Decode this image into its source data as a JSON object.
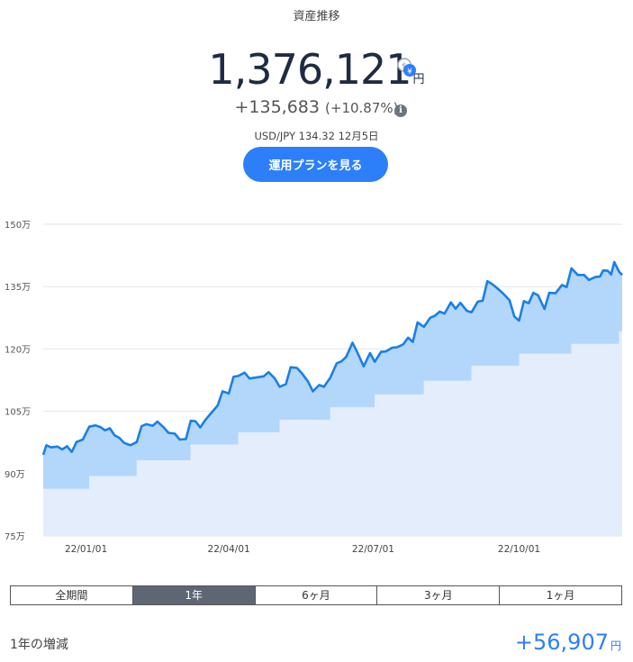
{
  "header": {
    "title": "資産推移"
  },
  "summary": {
    "total": "1,376,121",
    "total_unit": "円",
    "change": "+135,683",
    "change_pct": "(+10.87%)",
    "fx_label": "USD/JPY 134.32 12月5日",
    "plan_button": "運用プランを見る",
    "currency_toggle_icon": "dollar-yen-toggle-icon",
    "info_icon": "info-icon"
  },
  "colors": {
    "accent": "#2d7ff9",
    "line": "#1a7fe8",
    "area_upper": "#b3d7fb",
    "area_lower": "#e3edfb",
    "active_tab": "#5f6673"
  },
  "chart_data": {
    "type": "area",
    "y_ticks": [
      "150万",
      "135万",
      "120万",
      "105万",
      "90万",
      "75万"
    ],
    "ylim": [
      75,
      150
    ],
    "x_ticks": [
      {
        "label": "22/01/01",
        "x": "2022-01-01"
      },
      {
        "label": "22/04/01",
        "x": "2022-04-01"
      },
      {
        "label": "22/07/01",
        "x": "2022-07-01"
      },
      {
        "label": "22/10/01",
        "x": "2022-10-01"
      }
    ],
    "xlim": [
      "2021-12-05",
      "2022-12-05"
    ],
    "grid": true,
    "series": [
      {
        "role": "valuation",
        "points": [
          [
            "2021-12-05",
            94.5
          ],
          [
            "2021-12-07",
            96.8
          ],
          [
            "2021-12-10",
            96.3
          ],
          [
            "2021-12-14",
            96.5
          ],
          [
            "2021-12-17",
            95.8
          ],
          [
            "2021-12-20",
            96.6
          ],
          [
            "2021-12-23",
            95.2
          ],
          [
            "2021-12-26",
            97.6
          ],
          [
            "2021-12-30",
            98.2
          ],
          [
            "2022-01-03",
            101.3
          ],
          [
            "2022-01-07",
            101.6
          ],
          [
            "2022-01-10",
            101.2
          ],
          [
            "2022-01-13",
            100.4
          ],
          [
            "2022-01-16",
            100.9
          ],
          [
            "2022-01-19",
            99.2
          ],
          [
            "2022-01-22",
            98.6
          ],
          [
            "2022-01-25",
            97.4
          ],
          [
            "2022-01-29",
            96.8
          ],
          [
            "2022-02-02",
            97.6
          ],
          [
            "2022-02-05",
            101.4
          ],
          [
            "2022-02-08",
            101.9
          ],
          [
            "2022-02-12",
            101.5
          ],
          [
            "2022-02-15",
            102.5
          ],
          [
            "2022-02-19",
            101.1
          ],
          [
            "2022-02-22",
            99.8
          ],
          [
            "2022-02-26",
            99.6
          ],
          [
            "2022-03-01",
            98.2
          ],
          [
            "2022-03-05",
            98.3
          ],
          [
            "2022-03-08",
            102.7
          ],
          [
            "2022-03-11",
            102.6
          ],
          [
            "2022-03-14",
            101.1
          ],
          [
            "2022-03-17",
            102.8
          ],
          [
            "2022-03-21",
            104.6
          ],
          [
            "2022-03-25",
            106.4
          ],
          [
            "2022-03-28",
            109.8
          ],
          [
            "2022-04-01",
            109.3
          ],
          [
            "2022-04-04",
            113.3
          ],
          [
            "2022-04-07",
            113.5
          ],
          [
            "2022-04-11",
            114.3
          ],
          [
            "2022-04-14",
            112.9
          ],
          [
            "2022-04-18",
            113.1
          ],
          [
            "2022-04-23",
            113.4
          ],
          [
            "2022-04-26",
            114.4
          ],
          [
            "2022-04-30",
            112.9
          ],
          [
            "2022-05-03",
            110.9
          ],
          [
            "2022-05-07",
            111.5
          ],
          [
            "2022-05-10",
            115.6
          ],
          [
            "2022-05-14",
            115.4
          ],
          [
            "2022-05-17",
            114.2
          ],
          [
            "2022-05-21",
            112.1
          ],
          [
            "2022-05-24",
            109.8
          ],
          [
            "2022-05-28",
            111.3
          ],
          [
            "2022-05-31",
            110.9
          ],
          [
            "2022-06-04",
            113.1
          ],
          [
            "2022-06-08",
            116.5
          ],
          [
            "2022-06-11",
            117.0
          ],
          [
            "2022-06-14",
            118.1
          ],
          [
            "2022-06-18",
            121.5
          ],
          [
            "2022-06-21",
            119.2
          ],
          [
            "2022-06-25",
            115.8
          ],
          [
            "2022-06-29",
            119.0
          ],
          [
            "2022-07-02",
            116.9
          ],
          [
            "2022-07-06",
            119.3
          ],
          [
            "2022-07-09",
            119.4
          ],
          [
            "2022-07-13",
            120.3
          ],
          [
            "2022-07-16",
            120.4
          ],
          [
            "2022-07-20",
            121.1
          ],
          [
            "2022-07-23",
            122.7
          ],
          [
            "2022-07-26",
            121.7
          ],
          [
            "2022-07-29",
            126.4
          ],
          [
            "2022-08-02",
            125.3
          ],
          [
            "2022-08-06",
            127.5
          ],
          [
            "2022-08-09",
            128.0
          ],
          [
            "2022-08-12",
            129.0
          ],
          [
            "2022-08-15",
            128.5
          ],
          [
            "2022-08-19",
            131.2
          ],
          [
            "2022-08-22",
            129.7
          ],
          [
            "2022-08-25",
            131.1
          ],
          [
            "2022-08-29",
            129.2
          ],
          [
            "2022-09-01",
            128.8
          ],
          [
            "2022-09-05",
            131.4
          ],
          [
            "2022-09-08",
            131.6
          ],
          [
            "2022-09-11",
            136.3
          ],
          [
            "2022-09-14",
            135.6
          ],
          [
            "2022-09-17",
            134.7
          ],
          [
            "2022-09-21",
            133.3
          ],
          [
            "2022-09-25",
            131.7
          ],
          [
            "2022-09-28",
            127.8
          ],
          [
            "2022-10-01",
            126.8
          ],
          [
            "2022-10-04",
            131.5
          ],
          [
            "2022-10-07",
            131.0
          ],
          [
            "2022-10-10",
            133.5
          ],
          [
            "2022-10-13",
            132.9
          ],
          [
            "2022-10-17",
            129.6
          ],
          [
            "2022-10-20",
            133.5
          ],
          [
            "2022-10-24",
            133.4
          ],
          [
            "2022-10-28",
            135.4
          ],
          [
            "2022-10-31",
            134.9
          ],
          [
            "2022-11-03",
            139.4
          ],
          [
            "2022-11-07",
            137.8
          ],
          [
            "2022-11-11",
            137.8
          ],
          [
            "2022-11-14",
            136.6
          ],
          [
            "2022-11-18",
            137.3
          ],
          [
            "2022-11-21",
            137.4
          ],
          [
            "2022-11-23",
            138.9
          ],
          [
            "2022-11-26",
            138.8
          ],
          [
            "2022-11-28",
            137.9
          ],
          [
            "2022-11-30",
            140.9
          ],
          [
            "2022-12-03",
            138.6
          ],
          [
            "2022-12-05",
            137.8
          ]
        ]
      },
      {
        "role": "invested",
        "points": [
          [
            "2021-12-05",
            86.3
          ],
          [
            "2022-01-03",
            86.3
          ],
          [
            "2022-01-03",
            89.4
          ],
          [
            "2022-02-02",
            89.4
          ],
          [
            "2022-02-02",
            93.2
          ],
          [
            "2022-03-08",
            93.2
          ],
          [
            "2022-03-08",
            97.0
          ],
          [
            "2022-04-07",
            97.0
          ],
          [
            "2022-04-07",
            99.9
          ],
          [
            "2022-05-03",
            99.9
          ],
          [
            "2022-05-03",
            102.9
          ],
          [
            "2022-06-04",
            102.9
          ],
          [
            "2022-06-04",
            105.9
          ],
          [
            "2022-07-02",
            105.9
          ],
          [
            "2022-07-02",
            109.0
          ],
          [
            "2022-08-02",
            109.0
          ],
          [
            "2022-08-02",
            112.3
          ],
          [
            "2022-09-01",
            112.3
          ],
          [
            "2022-09-01",
            115.9
          ],
          [
            "2022-10-01",
            115.9
          ],
          [
            "2022-10-01",
            118.8
          ],
          [
            "2022-11-03",
            118.8
          ],
          [
            "2022-11-03",
            121.2
          ],
          [
            "2022-12-03",
            121.2
          ],
          [
            "2022-12-03",
            124.2
          ],
          [
            "2022-12-05",
            124.2
          ]
        ]
      }
    ]
  },
  "tabs": [
    {
      "label": "全期間",
      "active": false
    },
    {
      "label": "1年",
      "active": true
    },
    {
      "label": "6ヶ月",
      "active": false
    },
    {
      "label": "3ヶ月",
      "active": false
    },
    {
      "label": "1ヶ月",
      "active": false
    }
  ],
  "period_summary": {
    "label": "1年の増減",
    "value": "+56,907",
    "unit": "円"
  }
}
